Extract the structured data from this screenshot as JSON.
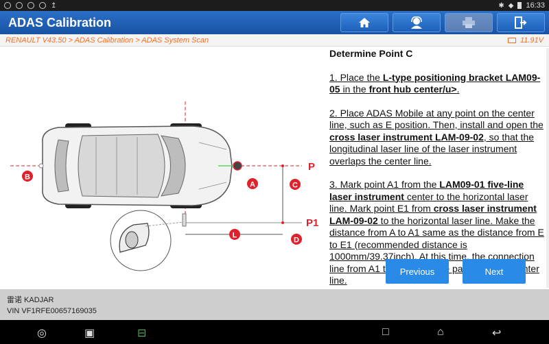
{
  "statusbar": {
    "time": "16:33"
  },
  "header": {
    "title": "ADAS Calibration",
    "buttons": [
      {
        "icon": "home-icon",
        "glyph": "⌂"
      },
      {
        "icon": "support-icon",
        "glyph": "☺"
      },
      {
        "icon": "print-icon",
        "glyph": "⎙"
      },
      {
        "icon": "exit-icon",
        "glyph": "⇥"
      }
    ]
  },
  "breadcrumb": {
    "path": "RENAULT V43.50 > ADAS Calibration > ADAS System Scan",
    "voltage": "11.91V"
  },
  "diagram_labels": {
    "p": "P",
    "p1": "P1",
    "a": "A",
    "b": "B",
    "c": "C",
    "d": "D",
    "l": "L"
  },
  "instructions": {
    "heading": "Determine Point C",
    "step1": {
      "t1": "1. Place the ",
      "b1": "L-type positioning bracket LAM09-05",
      "t2": " in the ",
      "b2": "front hub center/u>",
      "t3": "."
    },
    "step2": {
      "t1": "2. Place ADAS Mobile at any point on the center line, such as E position. Then, install and open the ",
      "b1": "cross laser instrument LAM-09-02",
      "t2": ", so that the longitudinal laser line of the laser instrument overlaps the center line."
    },
    "step3": {
      "t1": "3. Mark point A1 from the ",
      "b1": "LAM09-01 five-line laser instrument",
      "t2": " center to the horizontal laser line. Mark point E1 from ",
      "b2": "cross laser instrument LAM-09-02",
      "t3": " to the horizontal laser line. Make the distance from A to A1 same as the distance from E to E1 (recommended distance is 1000mm/39.37inch). At this time, the connection line from A1 to E1 should be parallel to the center line."
    }
  },
  "buttons": {
    "previous": "Previous",
    "next": "Next"
  },
  "vehicle": {
    "name": "雷诺 KADJAR",
    "vin": "VIN VF1RFE00657169035"
  },
  "colors": {
    "accent": "#1d5db0",
    "marker": "#e0202a",
    "breadcrumb": "#ff6a1a",
    "button": "#2a8ae8"
  }
}
